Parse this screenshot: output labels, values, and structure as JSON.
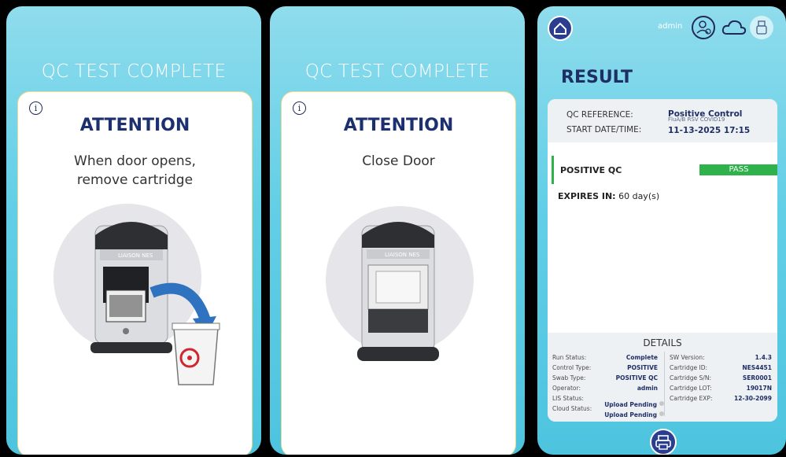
{
  "screen1": {
    "title": "QC TEST COMPLETE",
    "info_icon": "i",
    "heading": "ATTENTION",
    "message_line1": "When door opens,",
    "message_line2": "remove cartridge",
    "device_brand": "LIAISON NES"
  },
  "screen2": {
    "title": "QC TEST COMPLETE",
    "info_icon": "i",
    "heading": "ATTENTION",
    "message": "Close Door",
    "device_brand": "LIAISON NES"
  },
  "screen3": {
    "user": "admin",
    "icons": [
      "home-icon",
      "user-gear-icon",
      "cloud-icon",
      "usb-icon",
      "printer-icon"
    ],
    "title": "RESULT",
    "qc_reference_label": "QC REFERENCE:",
    "qc_reference_value": "Positive Control",
    "qc_reference_sub": "FluA/B RSV COVID19",
    "start_label": "START DATE/TIME:",
    "start_value": "11-13-2025 17:15",
    "qc_name": "POSITIVE QC",
    "qc_status": "PASS",
    "expires_label": "EXPIRES IN:",
    "expires_value": "60 day(s)",
    "details_title": "DETAILS",
    "details_left": [
      {
        "label": "Run Status:",
        "value": "Complete"
      },
      {
        "label": "Control Type:",
        "value": "POSITIVE"
      },
      {
        "label": "Swab Type:",
        "value": "POSITIVE QC"
      },
      {
        "label": "Operator:",
        "value": "admin"
      },
      {
        "label": "LIS Status:",
        "value": "Upload Pending"
      },
      {
        "label": "Cloud Status:",
        "value": "Upload Pending"
      }
    ],
    "details_right": [
      {
        "label": "SW Version:",
        "value": "1.4.3"
      },
      {
        "label": "Cartridge ID:",
        "value": "NES4451"
      },
      {
        "label": "Cartridge S/N:",
        "value": "SER0001"
      },
      {
        "label": "Cartridge LOT:",
        "value": "19017N"
      },
      {
        "label": "Cartridge EXP:",
        "value": "12-30-2099"
      }
    ],
    "colors": {
      "accent": "#2a3d8e",
      "pass": "#2fb24b",
      "title": "#1f2f66"
    }
  }
}
